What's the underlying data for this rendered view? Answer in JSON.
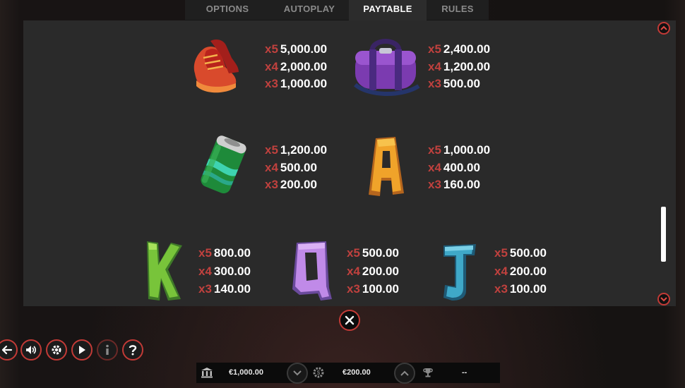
{
  "tabs": [
    {
      "label": "OPTIONS",
      "active": false
    },
    {
      "label": "AUTOPLAY",
      "active": false
    },
    {
      "label": "PAYTABLE",
      "active": true
    },
    {
      "label": "RULES",
      "active": false
    }
  ],
  "paytable": [
    {
      "symbol": "sneakers-icon",
      "pays": [
        {
          "mult": "x5",
          "amount": "5,000.00"
        },
        {
          "mult": "x4",
          "amount": "2,000.00"
        },
        {
          "mult": "x3",
          "amount": "1,000.00"
        }
      ]
    },
    {
      "symbol": "duffel-bag-icon",
      "pays": [
        {
          "mult": "x5",
          "amount": "2,400.00"
        },
        {
          "mult": "x4",
          "amount": "1,200.00"
        },
        {
          "mult": "x3",
          "amount": "500.00"
        }
      ]
    },
    {
      "symbol": "soda-can-icon",
      "pays": [
        {
          "mult": "x5",
          "amount": "1,200.00"
        },
        {
          "mult": "x4",
          "amount": "500.00"
        },
        {
          "mult": "x3",
          "amount": "200.00"
        }
      ]
    },
    {
      "symbol": "letter-a-icon",
      "letter": "A",
      "pays": [
        {
          "mult": "x5",
          "amount": "1,000.00"
        },
        {
          "mult": "x4",
          "amount": "400.00"
        },
        {
          "mult": "x3",
          "amount": "160.00"
        }
      ]
    },
    {
      "symbol": "letter-k-icon",
      "letter": "K",
      "pays": [
        {
          "mult": "x5",
          "amount": "800.00"
        },
        {
          "mult": "x4",
          "amount": "300.00"
        },
        {
          "mult": "x3",
          "amount": "140.00"
        }
      ]
    },
    {
      "symbol": "letter-q-icon",
      "letter": "Q",
      "pays": [
        {
          "mult": "x5",
          "amount": "500.00"
        },
        {
          "mult": "x4",
          "amount": "200.00"
        },
        {
          "mult": "x3",
          "amount": "100.00"
        }
      ]
    },
    {
      "symbol": "letter-j-icon",
      "letter": "J",
      "pays": [
        {
          "mult": "x5",
          "amount": "500.00"
        },
        {
          "mult": "x4",
          "amount": "200.00"
        },
        {
          "mult": "x3",
          "amount": "100.00"
        }
      ]
    }
  ],
  "scroll": {
    "position": 0.85
  },
  "toolbar": [
    "back-icon",
    "sound-icon",
    "settings-icon",
    "play-icon",
    "info-icon",
    "help-icon"
  ],
  "status": {
    "balance": "€1,000.00",
    "bet": "€200.00",
    "win": "--"
  },
  "colors": {
    "accent": "#c23a36",
    "multiplier": "#c0413e",
    "panel": "#2a2a2a"
  }
}
